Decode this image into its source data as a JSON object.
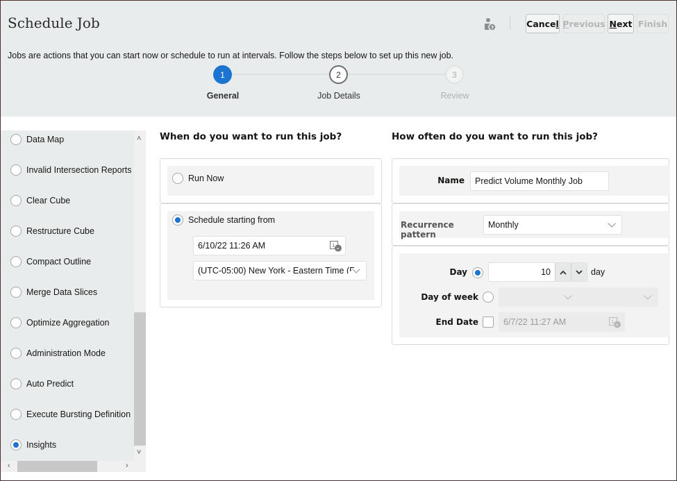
{
  "header": {
    "title": "Schedule Job",
    "intro": "Jobs are actions that you can start now or schedule to run at intervals. Follow the steps below to set up this new job.",
    "help_icon": "user-help-icon",
    "buttons": {
      "cancel": {
        "label": "Cance",
        "accel": "l",
        "enabled": true
      },
      "previous": {
        "label": "revious",
        "accel": "P",
        "enabled": false
      },
      "next": {
        "label": "ext",
        "accel": "N",
        "enabled": true
      },
      "finish": {
        "label": "Finish",
        "enabled": false
      }
    }
  },
  "train": {
    "steps": [
      {
        "number": "1",
        "label": "General",
        "state": "current"
      },
      {
        "number": "2",
        "label": "Job Details",
        "state": "next"
      },
      {
        "number": "3",
        "label": "Review",
        "state": "disabled"
      }
    ]
  },
  "sidebar": {
    "items": [
      {
        "label": "Data Map",
        "selected": false
      },
      {
        "label": "Invalid Intersection Reports",
        "selected": false
      },
      {
        "label": "Clear Cube",
        "selected": false
      },
      {
        "label": "Restructure Cube",
        "selected": false
      },
      {
        "label": "Compact Outline",
        "selected": false
      },
      {
        "label": "Merge Data Slices",
        "selected": false
      },
      {
        "label": "Optimize Aggregation",
        "selected": false
      },
      {
        "label": "Administration Mode",
        "selected": false
      },
      {
        "label": "Auto Predict",
        "selected": false
      },
      {
        "label": "Execute Bursting Definition",
        "selected": false
      },
      {
        "label": "Insights",
        "selected": true
      }
    ],
    "scroll": {
      "up": "^",
      "down": "v",
      "left": "<",
      "right": ">"
    }
  },
  "when": {
    "heading": "When do you want to run this job?",
    "run_now": {
      "label": "Run Now",
      "selected": false
    },
    "schedule": {
      "label": "Schedule starting from",
      "selected": true
    },
    "start_datetime": "6/10/22 11:26 AM",
    "timezone": "(UTC-05:00) New York - Eastern Time (E"
  },
  "often": {
    "heading": "How often do you want to run this job?",
    "name_label": "Name",
    "name_value": "Predict Volume Monthly Job",
    "recurrence_label": "Recurrence pattern",
    "recurrence_value": "Monthly",
    "day_label": "Day",
    "day_selected": true,
    "day_value": "10",
    "day_unit": "day",
    "dow_label": "Day of week",
    "dow_selected": false,
    "dow_value": "",
    "end_date_label": "End Date",
    "end_date_checked": false,
    "end_date_value": "6/7/22 11:27 AM"
  },
  "colors": {
    "accent": "#1b74cf",
    "header_bg": "#e9ecec",
    "panel_bg": "#f3f3f3"
  }
}
